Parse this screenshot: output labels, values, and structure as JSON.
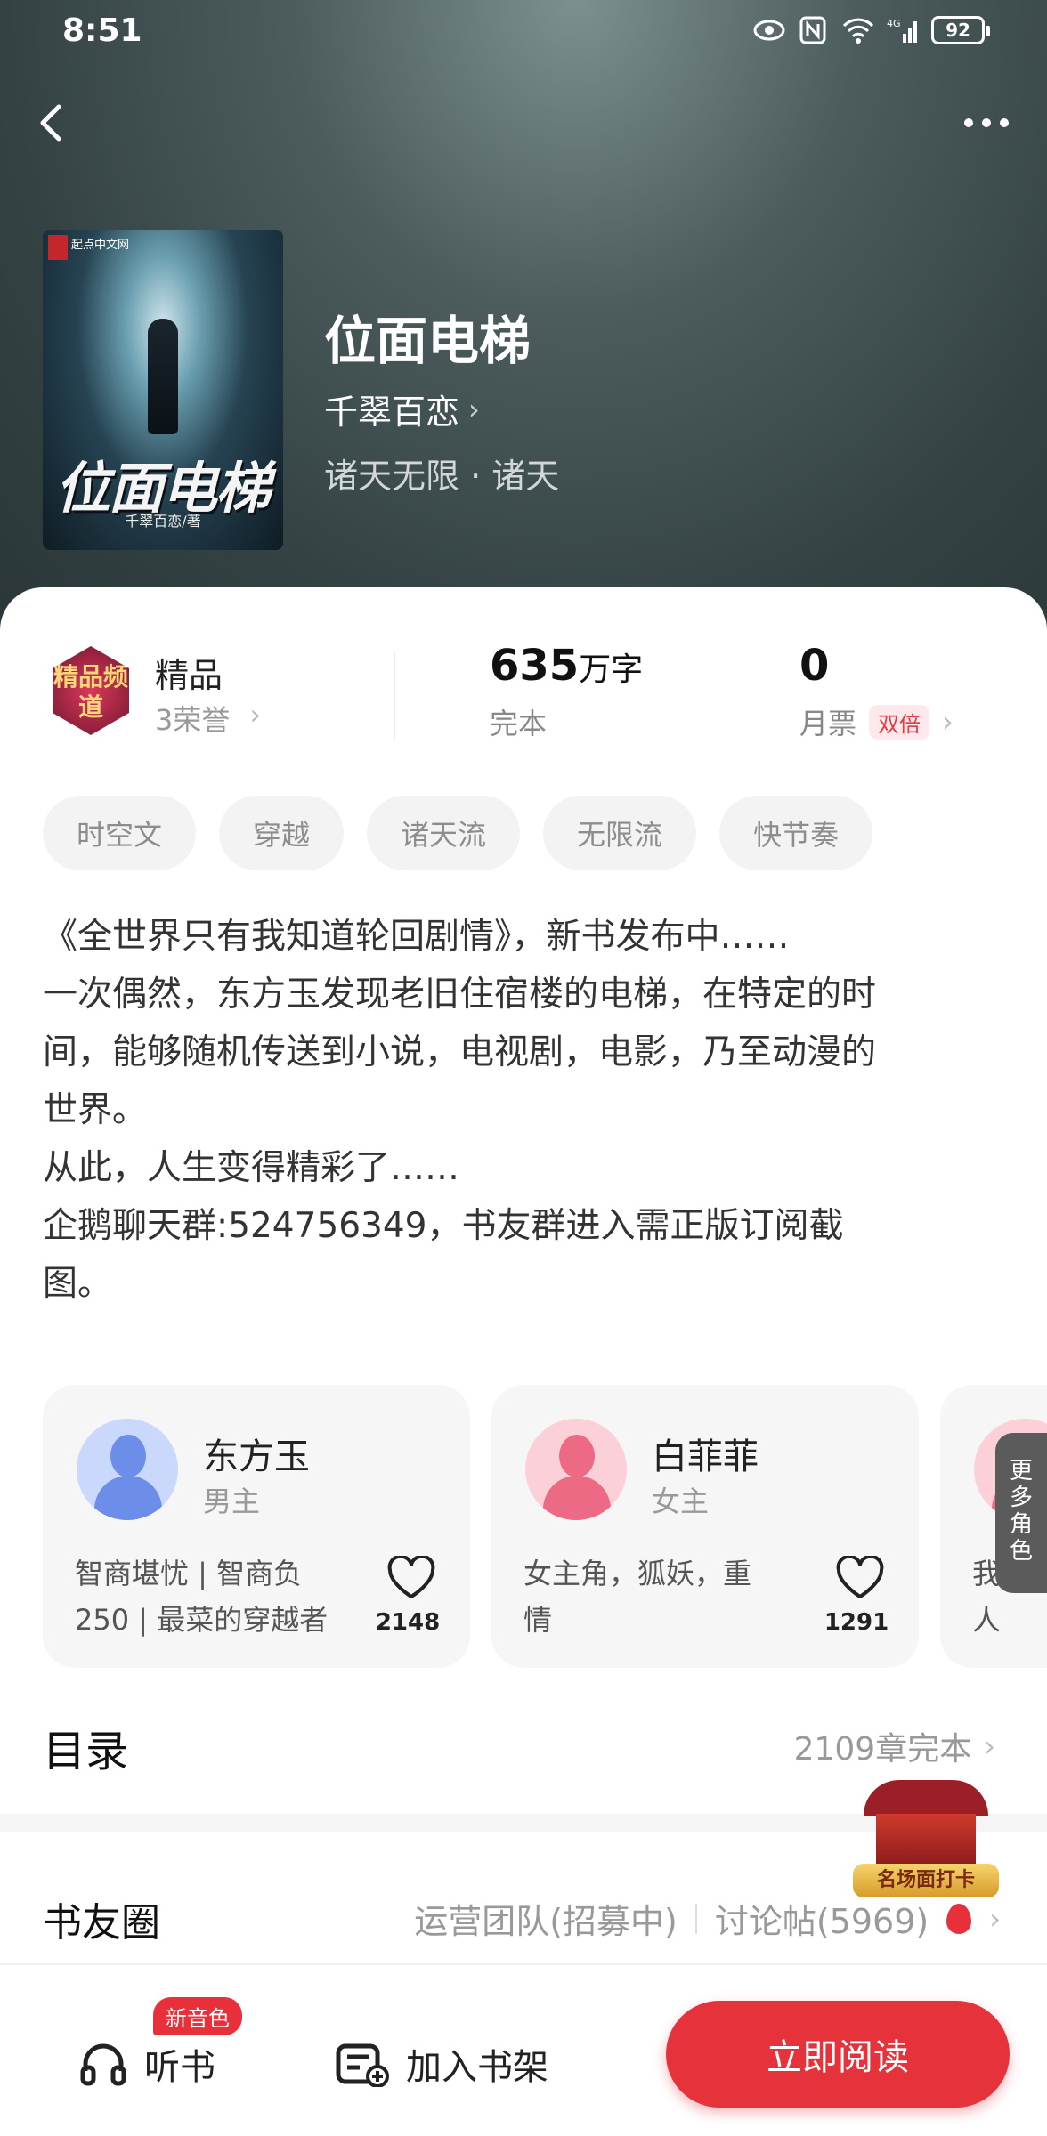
{
  "status_bar": {
    "time": "8:51",
    "battery": "92",
    "network": "4G"
  },
  "header": {
    "back_icon": "chevron-left-icon",
    "more_icon": "more-dots-icon"
  },
  "book": {
    "cover_publisher": "起点中文网",
    "cover_title": "位面电梯",
    "cover_author": "千翠百恋/著",
    "title": "位面电梯",
    "author": "千翠百恋",
    "genre": "诸天无限 · 诸天"
  },
  "stats": {
    "quality_label": "精品",
    "seal_text": "精品频道",
    "honors": "3荣誉",
    "word_count": "635",
    "word_unit": "万字",
    "status": "完本",
    "monthly_tickets": "0",
    "ticket_label": "月票",
    "double_badge": "双倍"
  },
  "tags": [
    "时空文",
    "穿越",
    "诸天流",
    "无限流",
    "快节奏"
  ],
  "description": [
    "《全世界只有我知道轮回剧情》，新书发布中……",
    "一次偶然，东方玉发现老旧住宿楼的电梯，在特定的时",
    "间，能够随机传送到小说，电视剧，电影，乃至动漫的",
    "世界。",
    "从此，人生变得精彩了……",
    "企鹅聊天群:524756349，书友群进入需正版订阅截",
    "图。"
  ],
  "characters": [
    {
      "name": "东方玉",
      "role": "男主",
      "desc_line1": "智商堪忧 | 智商负",
      "desc_line2": "250 | 最菜的穿越者",
      "likes": "2148",
      "accent": "#8fb0f6"
    },
    {
      "name": "白菲菲",
      "role": "女主",
      "desc_line1": "女主角，狐妖，重",
      "desc_line2": "情",
      "likes": "1291",
      "accent": "#f07d93"
    },
    {
      "desc_line1": "我爱在",
      "desc_line2": "人",
      "accent": "#f07d93"
    }
  ],
  "more_characters": "更多角色",
  "toc": {
    "title": "目录",
    "meta": "2109章完本"
  },
  "circle": {
    "title": "书友圈",
    "team": "运营团队(招募中)",
    "posts": "讨论帖(5969)"
  },
  "promo": {
    "label": "名场面打卡"
  },
  "bottom_bar": {
    "listen": "听书",
    "new_voice": "新音色",
    "add_shelf": "加入书架",
    "read_now": "立即阅读"
  },
  "colors": {
    "accent_red": "#e6323b",
    "hero_bg": "#3b4a4b"
  }
}
